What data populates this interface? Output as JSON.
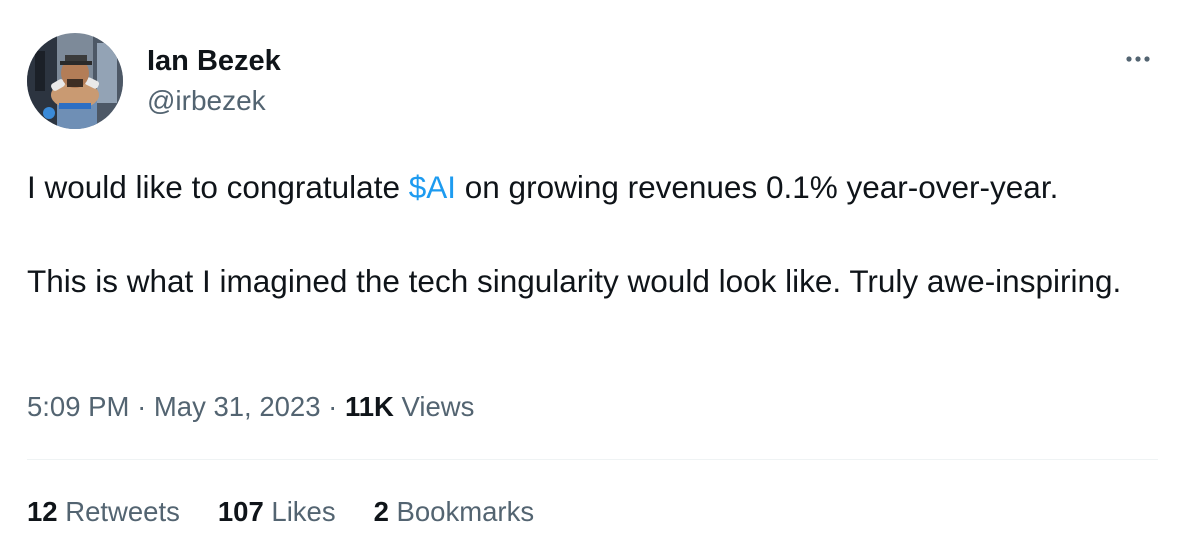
{
  "author": {
    "display_name": "Ian Bezek",
    "handle": "@irbezek",
    "avatar_icon": "profile-photo"
  },
  "more_icon": "ellipsis-icon",
  "tweet": {
    "line1_prefix": "I would like to congratulate ",
    "cashtag": "$AI",
    "line1_suffix": " on growing revenues 0.1% year-over-year.",
    "paragraph2": "This is what I imagined the tech singularity would look like. Truly awe-inspiring."
  },
  "meta": {
    "time": "5:09 PM",
    "separator": "·",
    "date": "May 31, 2023",
    "views_count": "11K",
    "views_label": "Views"
  },
  "stats": {
    "retweets_count": "12",
    "retweets_label": "Retweets",
    "likes_count": "107",
    "likes_label": "Likes",
    "bookmarks_count": "2",
    "bookmarks_label": "Bookmarks"
  },
  "colors": {
    "text": "#0f1419",
    "secondary": "#536471",
    "link": "#1d9bf0",
    "divider": "#eff3f4"
  }
}
